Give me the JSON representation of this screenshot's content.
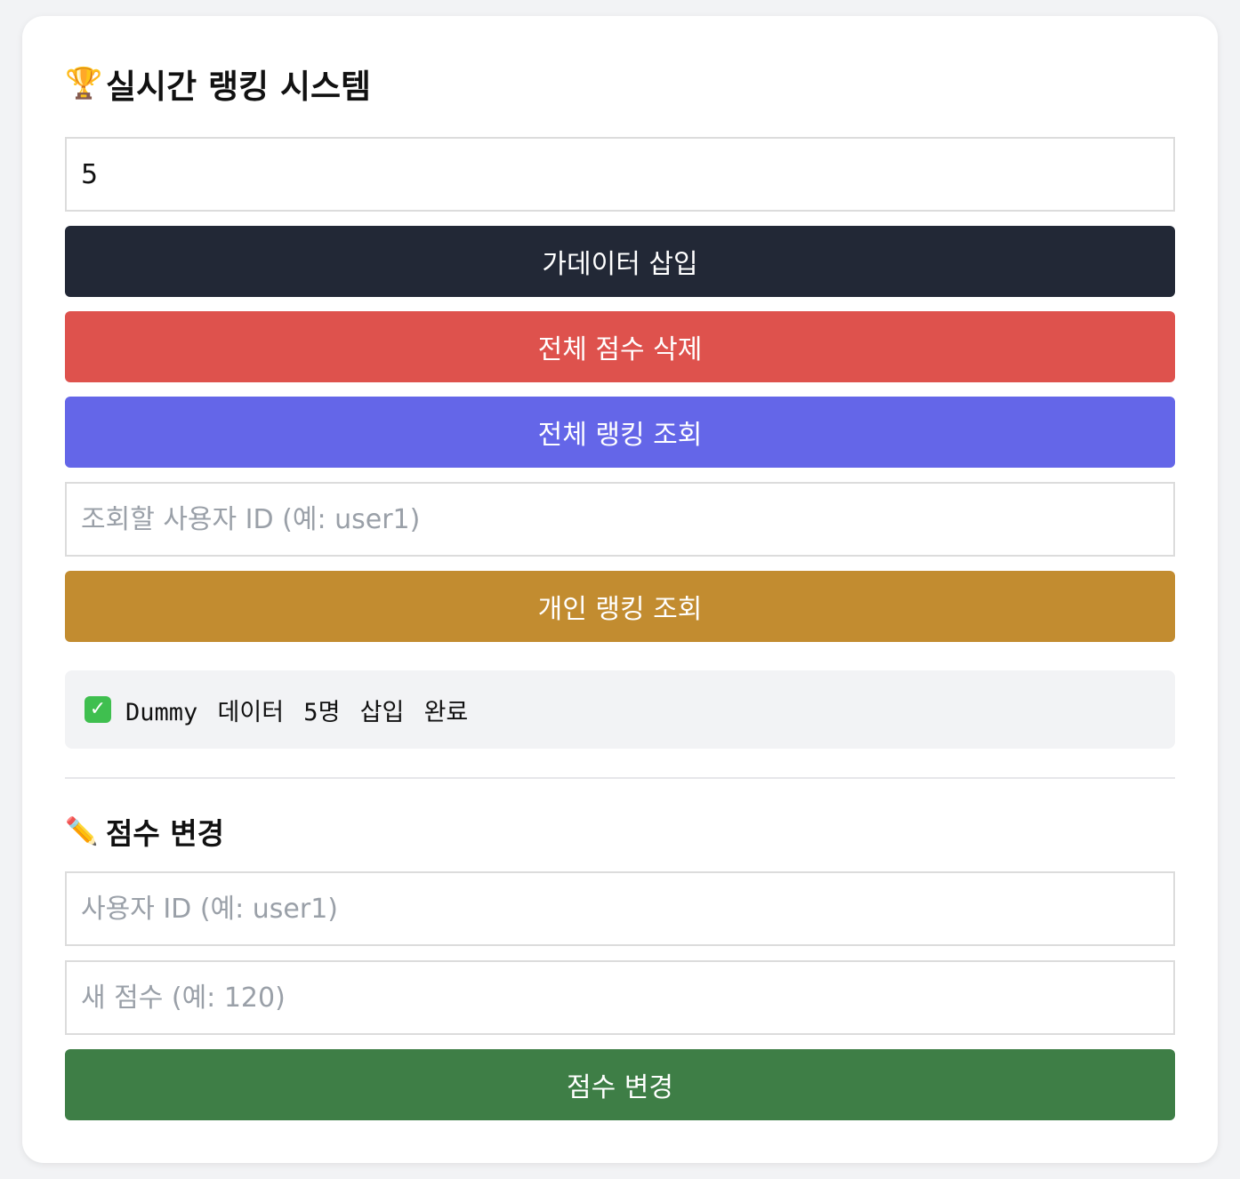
{
  "header": {
    "icon": "trophy-icon",
    "icon_glyph": "🏆",
    "title": "실시간 랭킹 시스템"
  },
  "ranking_panel": {
    "count_input": {
      "value": "5",
      "placeholder": ""
    },
    "insert_button": {
      "label": "가데이터 삽입",
      "color": "#222836"
    },
    "delete_all_button": {
      "label": "전체 점수 삭제",
      "color": "#de524d"
    },
    "view_all_button": {
      "label": "전체 랭킹 조회",
      "color": "#6466e8"
    },
    "user_id_input": {
      "value": "",
      "placeholder": "조회할 사용자 ID (예: user1)"
    },
    "view_personal_button": {
      "label": "개인 랭킹 조회",
      "color": "#c28c30"
    },
    "status": {
      "icon": "check-icon",
      "icon_glyph": "✓",
      "text": "Dummy 데이터 5명 삽입 완료"
    }
  },
  "score_change": {
    "icon": "pencil-icon",
    "icon_glyph": "✏️",
    "title": "점수 변경",
    "user_id_input": {
      "value": "",
      "placeholder": "사용자 ID (예: user1)"
    },
    "score_input": {
      "value": "",
      "placeholder": "새 점수 (예: 120)"
    },
    "submit_button": {
      "label": "점수 변경",
      "color": "#3e7e46"
    }
  }
}
